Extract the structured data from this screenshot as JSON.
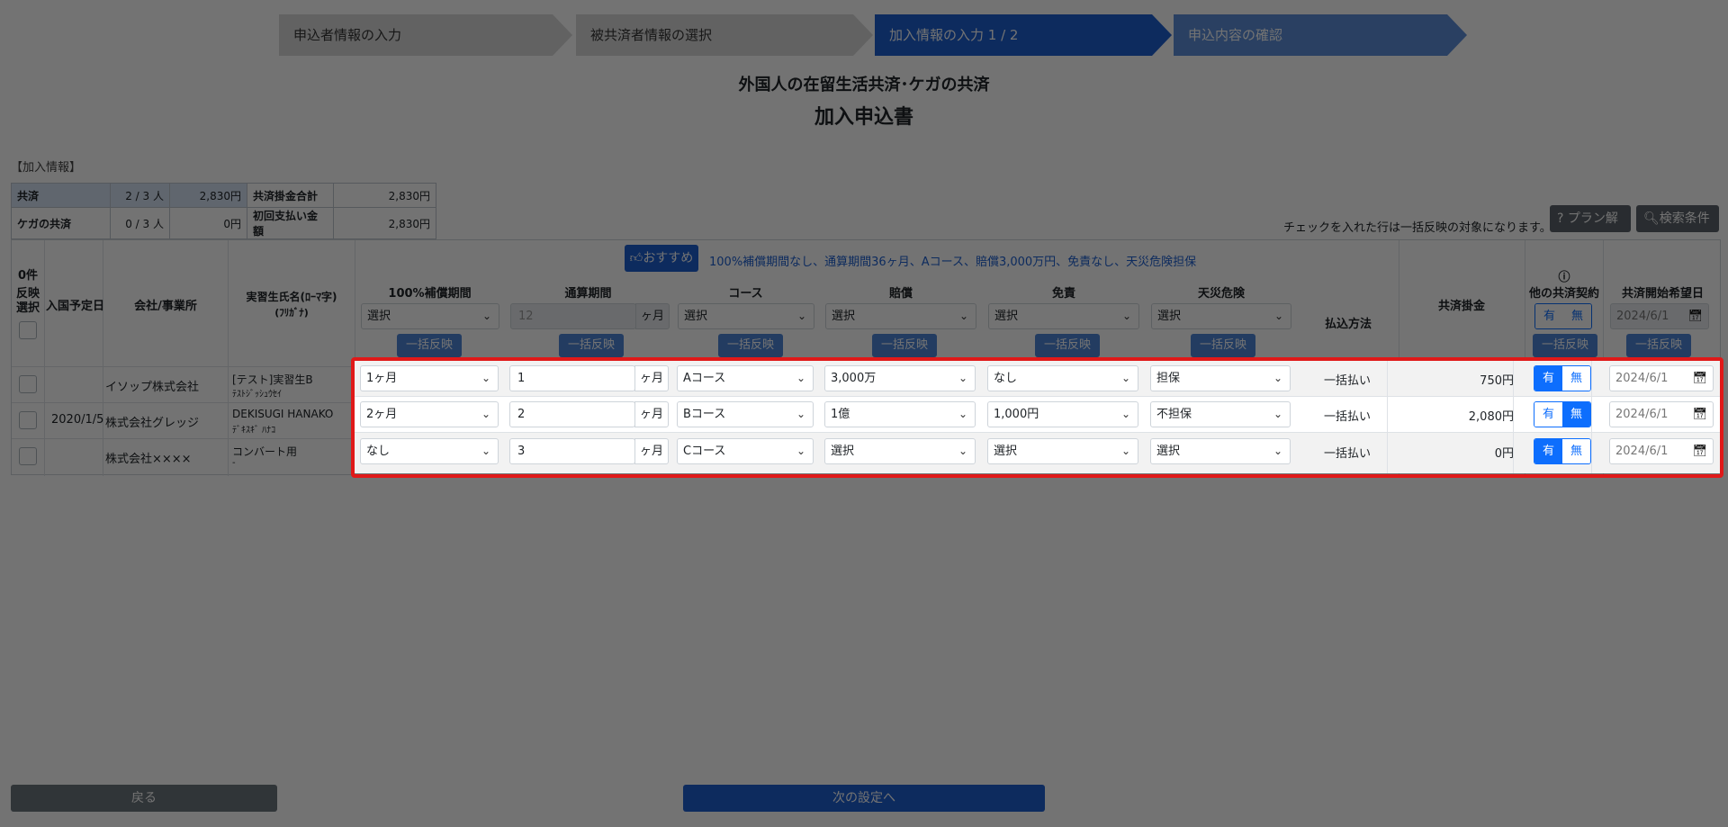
{
  "steps": [
    "申込者情報の入力",
    "被共済者情報の選択",
    "加入情報の入力 1 / 2",
    "申込内容の確認"
  ],
  "title": {
    "line1": "外国人の在留生活共済･ケガの共済",
    "line2": "加入申込書"
  },
  "summary": {
    "label": "【加入情報】",
    "rows": [
      {
        "name": "共済",
        "count": "2 / 3 人",
        "amount": "2,830円",
        "k2": "共済掛金合計",
        "v2": "2,830円"
      },
      {
        "name": "ケガの共済",
        "count": "0 / 3 人",
        "amount": "0円",
        "k2": "初回支払い金額",
        "v2": "2,830円"
      }
    ]
  },
  "note": "チェックを入れた行は一括反映の対象になります。",
  "buttons": {
    "plan": "プラン解説",
    "search": "検索条件",
    "back": "戻る",
    "next": "次の設定へ",
    "apply": "一括反映"
  },
  "recommend": {
    "label": "おすすめ",
    "text": "100%補償期間なし、通算期間36ヶ月、Aコース、賠償3,000万円、免責なし、天災危険担保"
  },
  "headers": {
    "select_count": "0件",
    "select_line2": "反映",
    "select_line3": "選択",
    "entry_date": "入国予定日",
    "company": "会社/事業所",
    "trainee": "実習生氏名(ﾛｰﾏ字)",
    "trainee_kana": "(ﾌﾘｶﾞﾅ)",
    "period100": "100%補償期間",
    "total_period": "通算期間",
    "course": "コース",
    "liability": "賠償",
    "deductible": "免責",
    "disaster": "天災危険",
    "payment": "払込方法",
    "premium": "共済掛金",
    "other_contract": "他の共済契約",
    "start_date": "共済開始希望日"
  },
  "bulk": {
    "period100": "選択",
    "total_period": "12",
    "unit": "ヶ月",
    "course": "選択",
    "liability": "選択",
    "deductible": "選択",
    "disaster": "選択",
    "toggle_yes": "有",
    "toggle_no": "無",
    "date": "2024/6/1"
  },
  "rows": [
    {
      "entry_date": "",
      "company": "イソップ株式会社",
      "name": "[テスト]実習生B",
      "kana": "ﾃｽﾄｼﾞｯｼｭｳｾｲ",
      "period100": "1ヶ月",
      "total": "1",
      "course": "Aコース",
      "liability": "3,000万",
      "deductible": "なし",
      "disaster": "担保",
      "payment": "一括払い",
      "premium": "750円",
      "other": "有",
      "date": "2024/6/1"
    },
    {
      "entry_date": "2020/1/5",
      "company": "株式会社グレッジ",
      "name": "DEKISUGI HANAKO",
      "kana": "ﾃﾞｷｽｷﾞ ﾊﾅｺ",
      "period100": "2ヶ月",
      "total": "2",
      "course": "Bコース",
      "liability": "1億",
      "deductible": "1,000円",
      "disaster": "不担保",
      "payment": "一括払い",
      "premium": "2,080円",
      "other": "無",
      "date": "2024/6/1"
    },
    {
      "entry_date": "",
      "company": "株式会社××××",
      "name": "コンバート用",
      "kana": "-",
      "period100": "なし",
      "total": "3",
      "course": "Cコース",
      "liability": "選択",
      "deductible": "選択",
      "disaster": "選択",
      "payment": "一括払い",
      "premium": "0円",
      "other": "有",
      "date": "2024/6/1"
    }
  ]
}
